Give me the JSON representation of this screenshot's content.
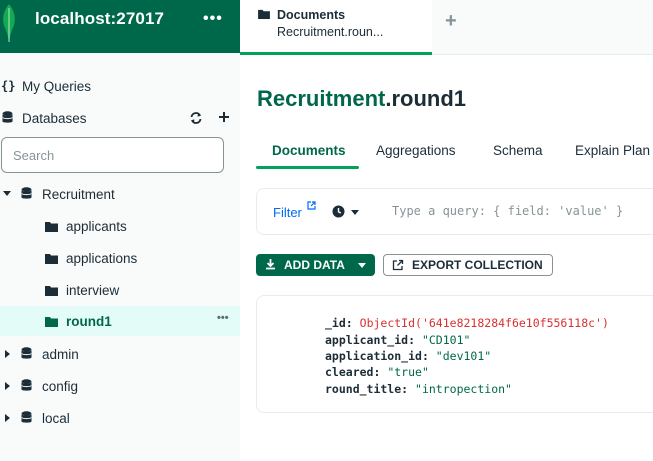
{
  "sidebar": {
    "connection_title": "localhost:27017",
    "more_label": "•••",
    "my_queries_label": "My Queries",
    "databases_label": "Databases",
    "search_placeholder": "Search",
    "databases": [
      {
        "name": "Recruitment",
        "expanded": true,
        "collections": [
          "applicants",
          "applications",
          "interview",
          "round1"
        ],
        "selected_collection": "round1"
      },
      {
        "name": "admin",
        "expanded": false
      },
      {
        "name": "config",
        "expanded": false
      },
      {
        "name": "local",
        "expanded": false
      }
    ],
    "row_more_label": "•••"
  },
  "tab": {
    "title": "Documents",
    "subtitle": "Recruitment.roun..."
  },
  "namespace": {
    "db": "Recruitment",
    "collection": ".round1"
  },
  "subtabs": [
    "Documents",
    "Aggregations",
    "Schema",
    "Explain Plan"
  ],
  "query": {
    "filter_label": "Filter",
    "placeholder": "Type a query: { field: 'value' }"
  },
  "actions": {
    "add_data": "ADD DATA",
    "export": "EXPORT COLLECTION"
  },
  "document": [
    {
      "key": "_id",
      "value": "ObjectId('641e8218284f6e10f556118c')",
      "kind": "oid"
    },
    {
      "key": "applicant_id",
      "value": "\"CD101\"",
      "kind": "str"
    },
    {
      "key": "application_id",
      "value": "\"dev101\"",
      "kind": "str"
    },
    {
      "key": "cleared",
      "value": "\"true\"",
      "kind": "str"
    },
    {
      "key": "round_title",
      "value": "\"intropection\"",
      "kind": "str"
    }
  ],
  "colors": {
    "brand_green": "#00684a",
    "accent_green": "#00a35c",
    "link_blue": "#016bf8",
    "oid_red": "#db3030",
    "selected_bg": "#e3fcf7"
  }
}
